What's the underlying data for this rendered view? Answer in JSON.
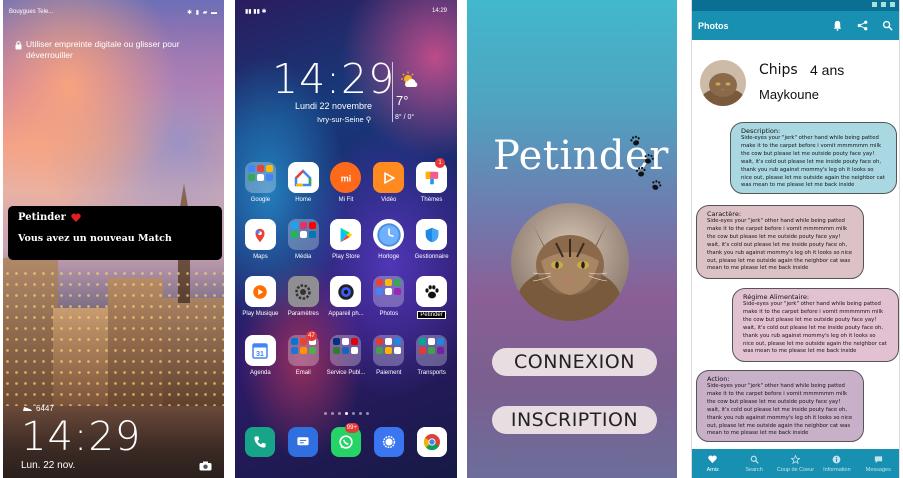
{
  "lockscreen": {
    "carrier": "Bouygues Tele...",
    "unlock_hint": "Utiliser empreinte digitale ou glisser pour déverrouiller",
    "notification": {
      "title": "Petinder",
      "message": "Vous avez un nouveau Match"
    },
    "steps": "6447",
    "time": "14:29",
    "date": "Lun. 22 nov."
  },
  "homescreen": {
    "status_time": "14:29",
    "clock": "14:29",
    "date": "Lundi 22 novembre",
    "location": "Ivry-sur-Seine",
    "temperature": "7°",
    "temp_range": "8° / 0°",
    "apps": [
      {
        "label": "Google",
        "icon": "google-folder-icon"
      },
      {
        "label": "Home",
        "icon": "google-home-icon"
      },
      {
        "label": "Mi Fit",
        "icon": "mi-fit-icon"
      },
      {
        "label": "Vidéo",
        "icon": "video-icon"
      },
      {
        "label": "Thèmes",
        "icon": "themes-icon",
        "badge": "1"
      },
      {
        "label": "Maps",
        "icon": "maps-icon"
      },
      {
        "label": "Média",
        "icon": "media-folder-icon"
      },
      {
        "label": "Play Store",
        "icon": "play-store-icon"
      },
      {
        "label": "Horloge",
        "icon": "clock-icon"
      },
      {
        "label": "Gestionnaire",
        "icon": "shield-icon"
      },
      {
        "label": "Play Musique",
        "icon": "play-music-icon"
      },
      {
        "label": "Paramètres",
        "icon": "settings-icon"
      },
      {
        "label": "Appareil ph...",
        "icon": "camera-icon"
      },
      {
        "label": "Photos",
        "icon": "photos-icon"
      },
      {
        "label": "Petinder",
        "icon": "paw-icon"
      },
      {
        "label": "Agenda",
        "icon": "calendar-icon"
      },
      {
        "label": "Email",
        "icon": "email-folder-icon",
        "badge": "47"
      },
      {
        "label": "Service Publ...",
        "icon": "service-folder-icon"
      },
      {
        "label": "Paiement",
        "icon": "payment-folder-icon"
      },
      {
        "label": "Transports",
        "icon": "transport-folder-icon"
      }
    ],
    "calendar_day": "31",
    "dock": [
      {
        "icon": "phone-icon"
      },
      {
        "icon": "messages-icon"
      },
      {
        "icon": "whatsapp-icon",
        "badge": "99+"
      },
      {
        "icon": "signal-icon"
      },
      {
        "icon": "chrome-icon"
      }
    ]
  },
  "landing": {
    "title": "Petinder",
    "login_label": "CONNEXION",
    "signup_label": "INSCRIPTION"
  },
  "profile": {
    "appbar_title": "Photos",
    "name": "Chips",
    "age": "4 ans",
    "breed": "Maykoune",
    "sections": [
      {
        "heading": "Description:",
        "color": "#a9d7e2"
      },
      {
        "heading": "Caractère:",
        "color": "#dcc2c6"
      },
      {
        "heading": "Régime Alimentaire:",
        "color": "#e2c2d2"
      },
      {
        "heading": "Action:",
        "color": "#c9b0c9"
      }
    ],
    "body_text": "Side-eyes your \"jerk\" other hand while being patted make it to the carpet before i vomit mmmmmm milk the cow but please let me outside pouty face yay! wait, it's cold out please let me inside pouty face oh, thank you rub against mommy's leg oh it looks so nice out, please let me outside again the neighbor cat was mean to me please let me back inside",
    "nav": [
      {
        "label": "Amis",
        "icon": "heart-icon"
      },
      {
        "label": "Search",
        "icon": "search-icon"
      },
      {
        "label": "Coup de Coeur",
        "icon": "star-icon"
      },
      {
        "label": "Information",
        "icon": "info-icon"
      },
      {
        "label": "Messages",
        "icon": "message-icon"
      }
    ],
    "colors": {
      "primary": "#1790b2",
      "statusbar": "#0b6f94"
    }
  }
}
